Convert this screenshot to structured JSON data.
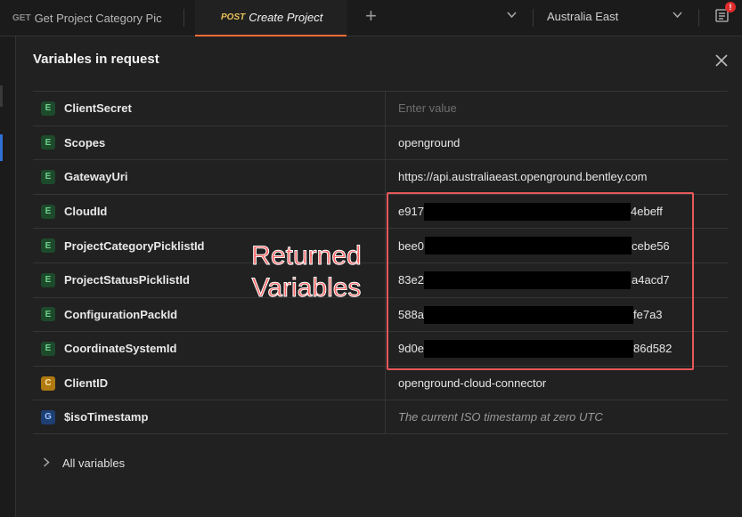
{
  "tabs": [
    {
      "method": "GET",
      "name": "Get Project Category Pic"
    },
    {
      "method": "POST",
      "name": "Create Project"
    }
  ],
  "environment": "Australia East",
  "notification_count": "!",
  "panel": {
    "title": "Variables in request",
    "rows": [
      {
        "type": "E",
        "key": "ClientSecret",
        "value": "",
        "placeholder": "Enter value"
      },
      {
        "type": "E",
        "key": "Scopes",
        "value": "openground"
      },
      {
        "type": "E",
        "key": "GatewayUri",
        "value": "https://api.australiaeast.openground.bentley.com"
      },
      {
        "type": "E",
        "key": "CloudId",
        "value_start": "e917",
        "value_end": "4ebeff"
      },
      {
        "type": "E",
        "key": "ProjectCategoryPicklistId",
        "value_start": "bee0",
        "value_end": "cebe56"
      },
      {
        "type": "E",
        "key": "ProjectStatusPicklistId",
        "value_start": "83e2",
        "value_end": "a4acd7"
      },
      {
        "type": "E",
        "key": "ConfigurationPackId",
        "value_start": "588a",
        "value_end": "fe7a3"
      },
      {
        "type": "E",
        "key": "CoordinateSystemId",
        "value_start": "9d0e",
        "value_end": "86d582"
      },
      {
        "type": "C",
        "key": "ClientID",
        "value": "openground-cloud-connector"
      },
      {
        "type": "G",
        "key": "$isoTimestamp",
        "value": "The current ISO timestamp at zero UTC"
      }
    ],
    "all_variables_label": "All variables"
  },
  "annotation": {
    "line1": "Returned",
    "line2": "Variables",
    "color": "#ff5f5f"
  },
  "colors": {
    "accent": "#ff6c37",
    "highlight": "#e8585a",
    "env_badge": "#1d4a2b",
    "collection_badge": "#b07a10",
    "global_badge": "#1e3f73"
  }
}
